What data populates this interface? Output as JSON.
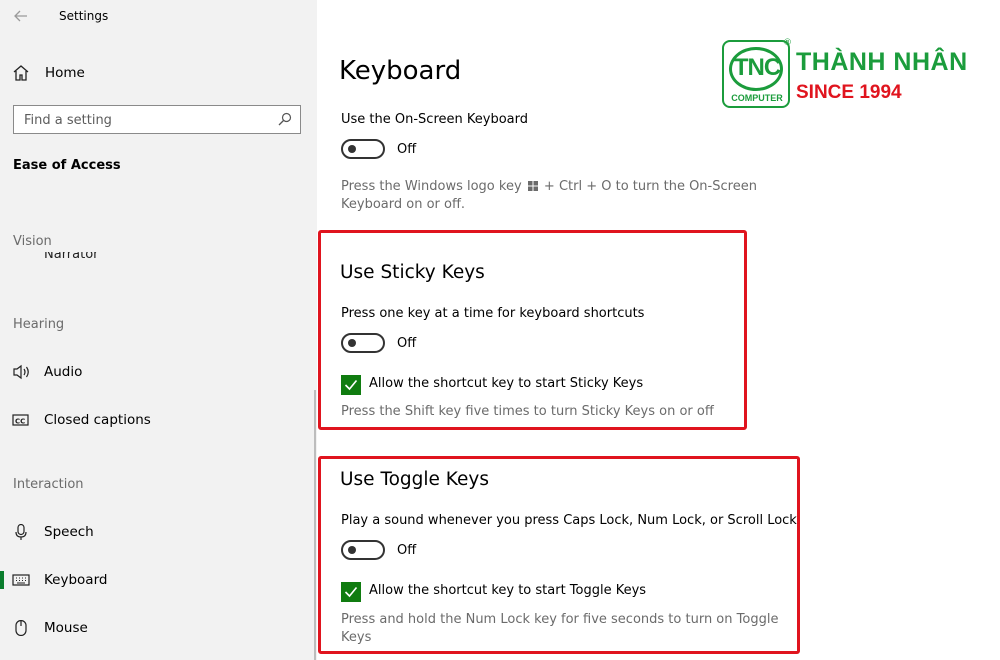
{
  "window": {
    "title": "Settings"
  },
  "sidebar": {
    "home_label": "Home",
    "search": {
      "placeholder": "Find a setting"
    },
    "section_title": "Ease of Access",
    "categories": {
      "vision": "Vision",
      "hearing": "Hearing",
      "interaction": "Interaction"
    },
    "partial_item": "Narrator",
    "items": [
      {
        "label": "Audio",
        "icon": "speaker-icon"
      },
      {
        "label": "Closed captions",
        "icon": "cc-icon"
      },
      {
        "label": "Speech",
        "icon": "microphone-icon"
      },
      {
        "label": "Keyboard",
        "icon": "keyboard-icon",
        "active": true
      },
      {
        "label": "Mouse",
        "icon": "mouse-icon"
      }
    ]
  },
  "main": {
    "page_title": "Keyboard",
    "onscreen": {
      "label": "Use the On-Screen Keyboard",
      "toggle_state": "Off",
      "desc_part1": "Press the Windows logo key",
      "desc_part2": "+ Ctrl + O to turn the On-Screen",
      "desc_line2": "Keyboard on or off."
    },
    "sticky": {
      "heading": "Use Sticky Keys",
      "label": "Press one key at a time for keyboard shortcuts",
      "toggle_state": "Off",
      "checkbox_label": "Allow the shortcut key to start Sticky Keys",
      "checkbox_checked": true,
      "desc": "Press the Shift key five times to turn Sticky Keys on or off"
    },
    "toggle_keys": {
      "heading": "Use Toggle Keys",
      "label": "Play a sound whenever you press Caps Lock, Num Lock, or Scroll Lock",
      "toggle_state": "Off",
      "checkbox_label": "Allow the shortcut key to start Toggle Keys",
      "checkbox_checked": true,
      "desc_line1": "Press and hold the Num Lock key for five seconds to turn on Toggle",
      "desc_line2": "Keys"
    }
  },
  "watermark": {
    "logo_text": "TNC",
    "logo_subtext": "COMPUTER",
    "brand": "THÀNH NHÂN",
    "tagline": "SINCE 1994"
  },
  "colors": {
    "accent_green": "#107c10",
    "highlight_red": "#e0141e",
    "sidebar_bg": "#f2f2f2",
    "brand_green": "#1b9c3c"
  }
}
